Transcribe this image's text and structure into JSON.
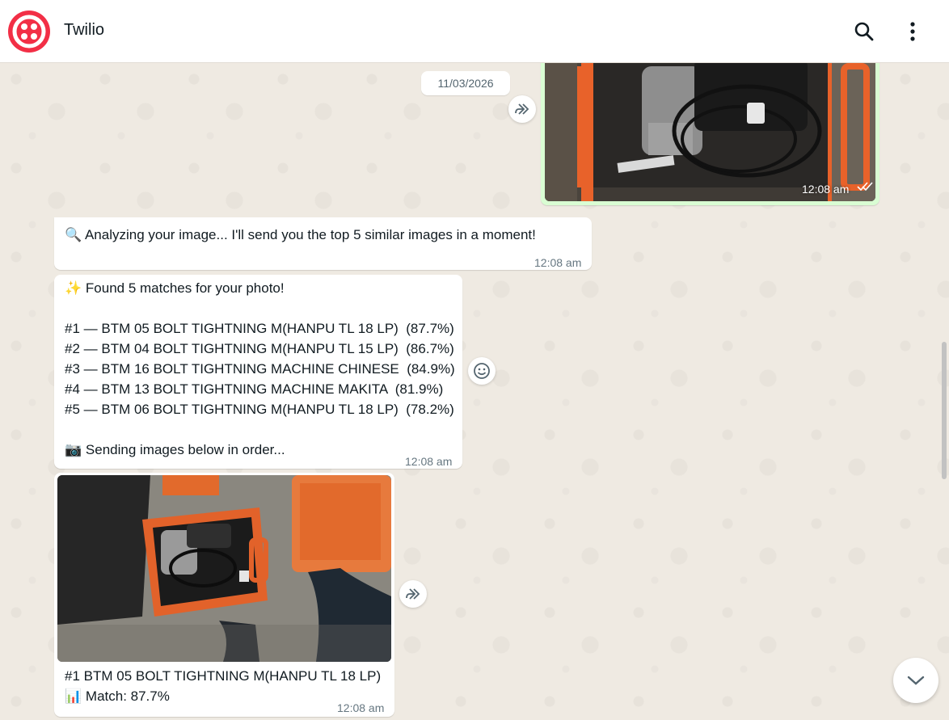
{
  "app": {
    "title": "Twilio",
    "brand_color": "#f22f46"
  },
  "header": {
    "search_icon": "search-icon",
    "menu_icon": "more-vertical-icon"
  },
  "chat": {
    "date_chip": "11/03/2026",
    "sent_image": {
      "time": "12:08 am",
      "status": "read-double-check"
    },
    "msg_analyzing": {
      "emoji": "🔍",
      "text": "Analyzing your image... I'll send you the top 5 similar images in a moment!",
      "time": "12:08 am"
    },
    "msg_found": {
      "heading_emoji": "✨",
      "heading": "Found 5 matches for your photo!",
      "matches": [
        "#1 — BTM 05 BOLT TIGHTNING M(HANPU TL 18 LP)  (87.7%)",
        "#2 — BTM 04 BOLT TIGHTNING M(HANPU TL 15 LP)  (86.7%)",
        "#3 — BTM 16 BOLT TIGHTNING MACHINE CHINESE  (84.9%)",
        "#4 — BTM 13 BOLT TIGHTNING MACHINE MAKITA  (81.9%)",
        "#5 — BTM 06 BOLT TIGHTNING M(HANPU TL 18 LP)  (78.2%)"
      ],
      "footer_emoji": "📷",
      "footer": "Sending images below in order...",
      "time": "12:08 am"
    },
    "msg_result1": {
      "caption_line1": "#1 BTM 05 BOLT TIGHTNING M(HANPU TL 18 LP)",
      "caption_emoji": "📊",
      "caption_line2": "Match: 87.7%",
      "time": "12:08 am"
    }
  },
  "colors": {
    "chat_bg": "#efeae2",
    "incoming": "#ffffff",
    "outgoing": "#d9fdd3",
    "text": "#111b21",
    "meta": "#667781"
  }
}
